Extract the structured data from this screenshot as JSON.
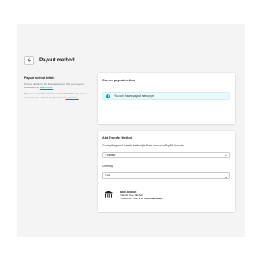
{
  "page": {
    "title": "Payout method"
  },
  "sidebar": {
    "title": "Payout method details",
    "paragraph1": "Provide details for the financial account that your payouts will be sent to.",
    "paragraph1_link": "Learn more.",
    "paragraph2": "Payouts received in currencies other than USD may have a conversion fee applied by Wyonmatter.",
    "paragraph2_link": "Learn more."
  },
  "current": {
    "title": "Current payout method",
    "banner_text": "You don't have a payout method yet."
  },
  "transfer": {
    "title": "Add Transfer Method",
    "country_label": "Country/Region of Transfer Method (ie. Bank Account or PayPal Account)",
    "country_value": "Thailand",
    "currency_label": "Currency",
    "currency_value": "THB",
    "method_name": "Bank Account",
    "fee_label": "Transfer Fee:",
    "fee_value": "No Fee",
    "time_label": "Processing Time:",
    "time_value": "1 to 4 business days"
  },
  "icons": {
    "back": "arrow-left-icon",
    "info": "info-icon",
    "caret": "select-caret-icon",
    "bank": "bank-icon"
  },
  "colors": {
    "link": "#2c6ecb",
    "banner_bg": "#ebf9fc",
    "info_icon": "#00a0ac"
  }
}
